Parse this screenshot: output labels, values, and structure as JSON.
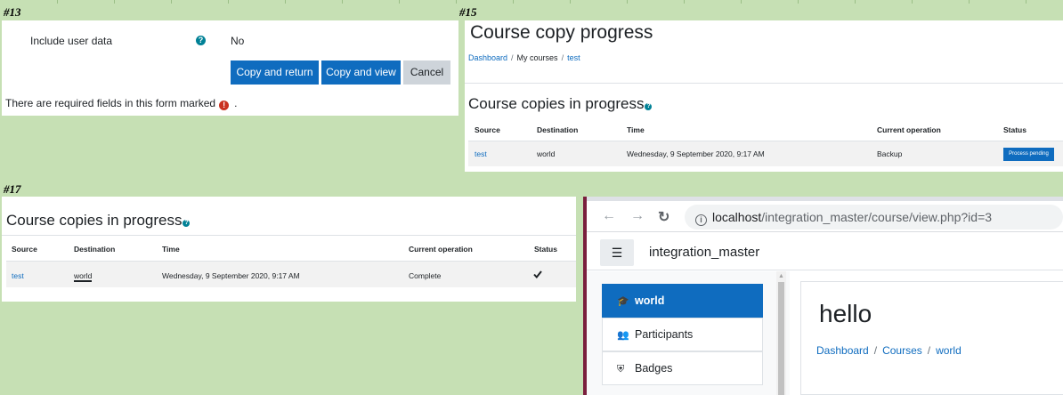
{
  "labels": {
    "p13": "#13",
    "p15": "#15",
    "p17": "#17"
  },
  "panel13": {
    "field_label": "Include user data",
    "field_value": "No",
    "buttons": {
      "copy_return": "Copy and return",
      "copy_view": "Copy and view",
      "cancel": "Cancel"
    },
    "required_note": "There are required fields in this form marked",
    "required_end": "."
  },
  "panel15": {
    "title": "Course copy progress",
    "breadcrumb": [
      "Dashboard",
      "My courses",
      "test"
    ],
    "heading": "Course copies in progress",
    "columns": [
      "Source",
      "Destination",
      "Time",
      "Current operation",
      "Status"
    ],
    "row": {
      "source": "test",
      "destination": "world",
      "time": "Wednesday, 9 September 2020, 9:17 AM",
      "operation": "Backup",
      "status": "Process pending"
    }
  },
  "panel17": {
    "heading": "Course copies in progress",
    "columns": [
      "Source",
      "Destination",
      "Time",
      "Current operation",
      "Status"
    ],
    "row": {
      "source": "test",
      "destination": "world",
      "time": "Wednesday, 9 September 2020, 9:17 AM",
      "operation": "Complete",
      "status_icon": "check-icon"
    }
  },
  "browser": {
    "url_host": "localhost",
    "url_path": "/integration_master/course/view.php?id=3",
    "site_name": "integration_master",
    "drawer": [
      {
        "label": "world",
        "icon": "graduation-cap-icon",
        "active": true
      },
      {
        "label": "Participants",
        "icon": "users-icon",
        "active": false
      },
      {
        "label": "Badges",
        "icon": "shield-icon",
        "active": false
      }
    ],
    "page_heading": "hello",
    "breadcrumb": [
      "Dashboard",
      "Courses",
      "world"
    ]
  },
  "colors": {
    "sheet_bg": "#c6e0b4",
    "primary": "#0f6cbf",
    "secondary": "#ced4da",
    "help": "#008196",
    "error": "#ca3120"
  }
}
